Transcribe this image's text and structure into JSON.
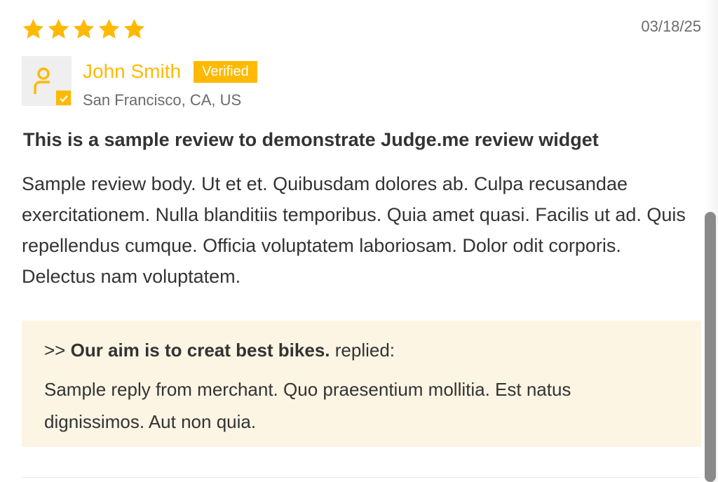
{
  "review": {
    "rating": 5,
    "max_rating": 5,
    "star_color": "#ffb900",
    "date": "03/18/25",
    "author": {
      "name": "John Smith",
      "badge": "Verified",
      "location": "San Francisco, CA, US",
      "avatar_icon": "user-verified-icon"
    },
    "title": "This is a sample review to demonstrate Judge.me review widget",
    "body": "Sample review body. Ut et et. Quibusdam dolores ab. Culpa recusandae exercitationem. Nulla blanditiis temporibus. Quia amet quasi. Facilis ut ad. Quis repellendus cumque. Officia voluptatem laboriosam. Dolor odit corporis. Delectus nam voluptatem."
  },
  "reply": {
    "prefix": ">> ",
    "merchant": "Our aim is to creat best bikes.",
    "suffix": " replied:",
    "body": "Sample reply from merchant. Quo praesentium mollitia. Est natus dignissimos. Aut non quia.",
    "background_color": "#fdf5e4"
  }
}
